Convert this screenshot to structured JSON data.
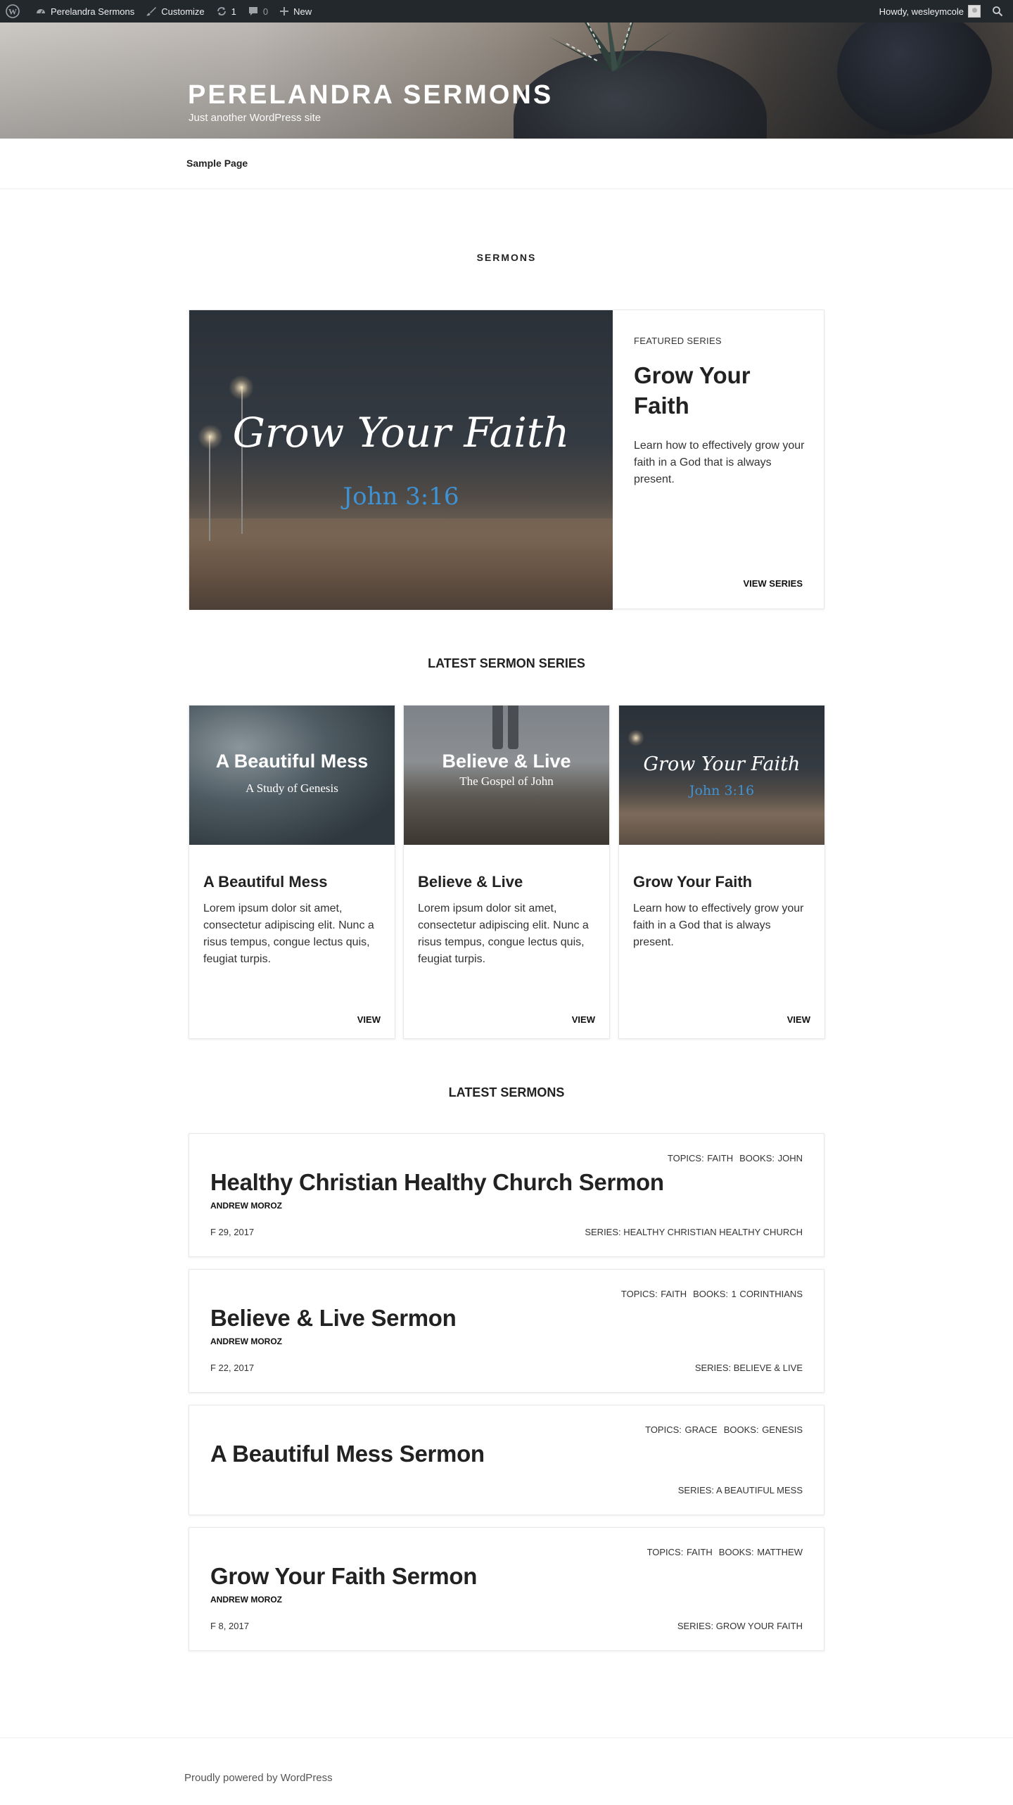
{
  "admin_bar": {
    "site_name": "Perelandra Sermons",
    "customize": "Customize",
    "updates_count": "1",
    "comments_count": "0",
    "new": "New",
    "howdy": "Howdy, wesleymcole"
  },
  "header": {
    "site_title": "PERELANDRA SERMONS",
    "tagline": "Just another WordPress site"
  },
  "nav": {
    "items": [
      {
        "label": "Sample Page"
      }
    ]
  },
  "main": {
    "heading": "SERMONS",
    "featured": {
      "image_title": "Grow Your Faith",
      "image_verse": "John 3:16",
      "label": "FEATURED SERIES",
      "title": "Grow Your Faith",
      "description": "Learn how to effectively grow your faith in a God that is always present.",
      "link": "VIEW SERIES"
    },
    "series_heading": "LATEST SERMON SERIES",
    "series": [
      {
        "image_title": "A Beautiful Mess",
        "image_subtitle": "A Study of Genesis",
        "title": "A Beautiful Mess",
        "description": "Lorem ipsum dolor sit amet, consectetur adipiscing elit. Nunc a risus tempus, congue lectus quis, feugiat turpis.",
        "link": "VIEW"
      },
      {
        "image_title": "Believe & Live",
        "image_subtitle": "The Gospel of John",
        "title": "Believe & Live",
        "description": "Lorem ipsum dolor sit amet, consectetur adipiscing elit. Nunc a risus tempus, congue lectus quis, feugiat turpis.",
        "link": "VIEW"
      },
      {
        "image_title": "Grow Your Faith",
        "image_subtitle": "John 3:16",
        "title": "Grow Your Faith",
        "description": "Learn how to effectively grow your faith in a God that is always present.",
        "link": "VIEW"
      }
    ],
    "sermons_heading": "LATEST SERMONS",
    "sermons": [
      {
        "topics": "TOPICS: FAITH",
        "books": "BOOKS: JOHN",
        "title": "Healthy Christian Healthy Church Sermon",
        "author": "ANDREW MOROZ",
        "date": "F 29, 2017",
        "series": "SERIES: HEALTHY CHRISTIAN HEALTHY CHURCH"
      },
      {
        "topics": "TOPICS: FAITH",
        "books": "BOOKS: 1 CORINTHIANS",
        "title": "Believe & Live Sermon",
        "author": "ANDREW MOROZ",
        "date": "F 22, 2017",
        "series": "SERIES: BELIEVE & LIVE"
      },
      {
        "topics": "TOPICS: GRACE",
        "books": "BOOKS: GENESIS",
        "title": "A Beautiful Mess Sermon",
        "author": "",
        "date": "",
        "series": "SERIES: A BEAUTIFUL MESS"
      },
      {
        "topics": "TOPICS: FAITH",
        "books": "BOOKS: MATTHEW",
        "title": "Grow Your Faith Sermon",
        "author": "ANDREW MOROZ",
        "date": "F 8, 2017",
        "series": "SERIES: GROW YOUR FAITH"
      }
    ]
  },
  "footer": {
    "text": "Proudly powered by WordPress"
  },
  "colors": {
    "admin_bar_bg": "#23282d",
    "verse_blue": "#3d93d6",
    "text": "#222222"
  }
}
